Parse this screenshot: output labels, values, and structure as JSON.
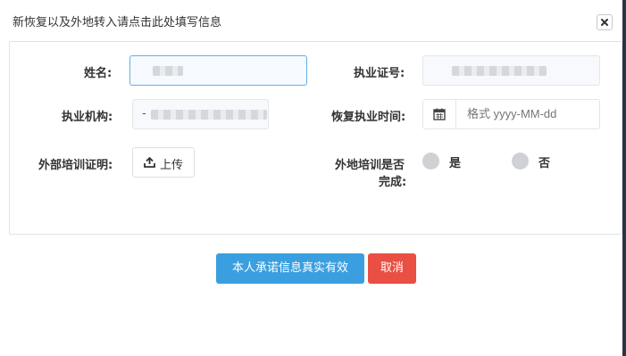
{
  "dialog": {
    "title": "新恢复以及外地转入请点击此处填写信息"
  },
  "form": {
    "name_label": "姓名:",
    "cert_label": "执业证号:",
    "org_label": "执业机构:",
    "org_value": "-",
    "resume_time_label": "恢复执业时间:",
    "date_placeholder": "格式 yyyy-MM-dd",
    "training_proof_label": "外部培训证明:",
    "upload_label": "上传",
    "remote_training_label_line1": "外地培训是否",
    "remote_training_label_line2": "完成:",
    "radio_yes": "是",
    "radio_no": "否"
  },
  "actions": {
    "confirm_label": "本人承诺信息真实有效",
    "cancel_label": "取消"
  },
  "colors": {
    "primary": "#3a9fe0",
    "danger": "#e94f42"
  },
  "icons": {
    "close": "close-icon",
    "calendar": "calendar-icon",
    "upload": "upload-icon"
  }
}
